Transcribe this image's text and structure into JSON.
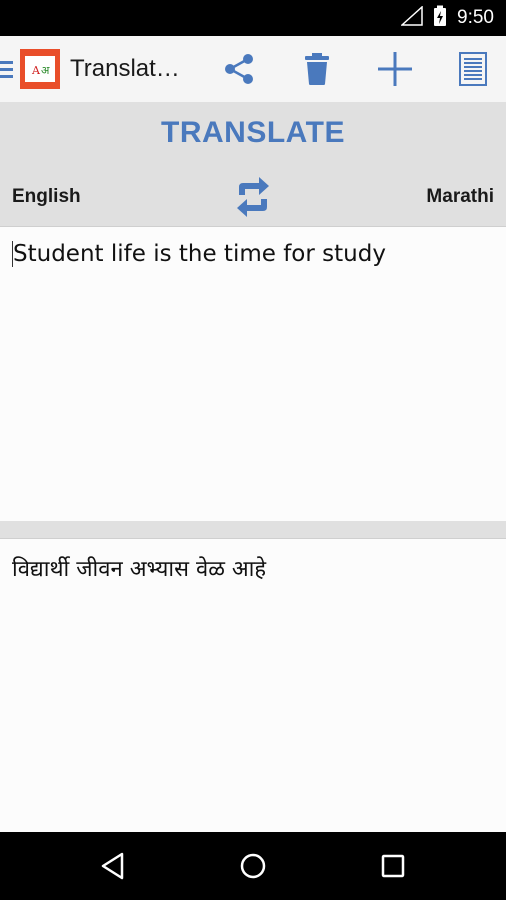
{
  "status_bar": {
    "time": "9:50"
  },
  "app_bar": {
    "logo_text": "A अ",
    "title": "Translat…",
    "icons": [
      "menu-icon",
      "share-icon",
      "trash-icon",
      "add-icon",
      "list-icon"
    ]
  },
  "translate": {
    "heading": "TRANSLATE",
    "source_lang": "English",
    "target_lang": "Marathi",
    "source_text": "Student life is the time for study",
    "target_text": "विद्यार्थी जीवन अभ्यास वेळ आहे"
  },
  "colors": {
    "accent": "#4a79bd",
    "app_bar_bg": "#f5f5f5",
    "content_bg": "#e0e0e0",
    "logo_bg": "#e94e2a"
  }
}
